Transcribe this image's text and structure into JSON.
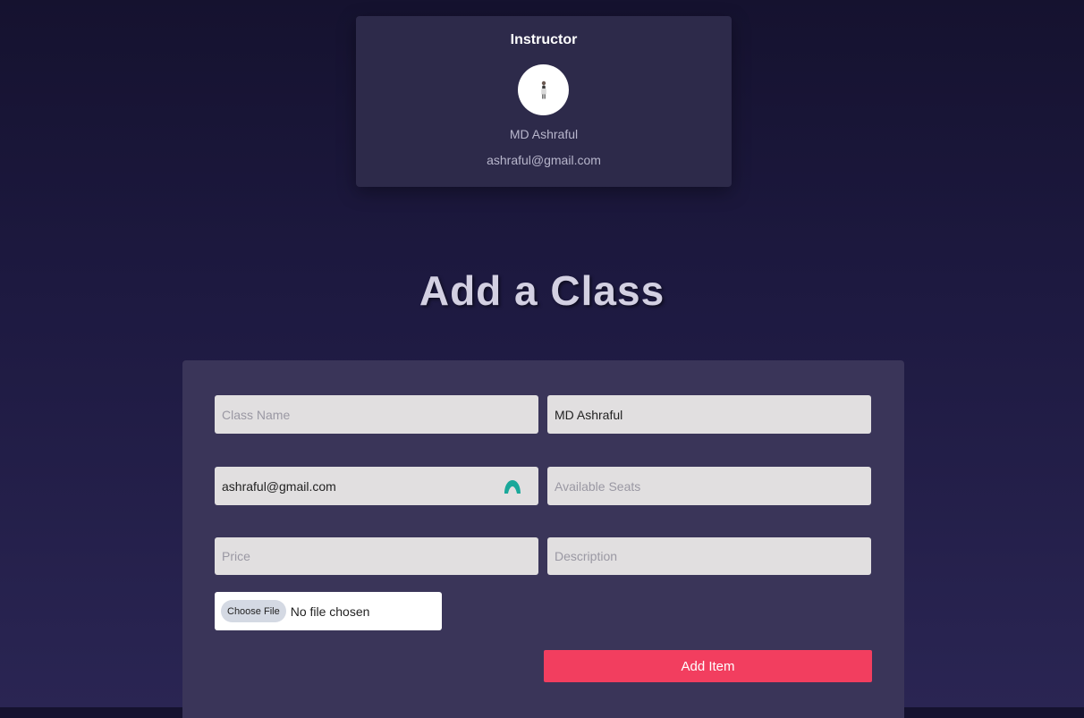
{
  "instructor_card": {
    "title": "Instructor",
    "name": "MD Ashraful",
    "email": "ashraful@gmail.com"
  },
  "heading": "Add a Class",
  "form": {
    "class_name": {
      "value": "",
      "placeholder": "Class Name"
    },
    "instructor_name": {
      "value": "MD Ashraful",
      "placeholder": ""
    },
    "instructor_email": {
      "value": "ashraful@gmail.com",
      "placeholder": ""
    },
    "available_seats": {
      "value": "",
      "placeholder": "Available Seats"
    },
    "price": {
      "value": "",
      "placeholder": "Price"
    },
    "description": {
      "value": "",
      "placeholder": "Description"
    },
    "file_button_label": "Choose File",
    "file_status": "No file chosen",
    "submit_label": "Add Item"
  },
  "colors": {
    "accent": "#f23e5f",
    "panel": "#3a3559",
    "card": "#2d2a4a",
    "extension_icon": "#1aa89a"
  },
  "icons": {
    "avatar": "person-photo",
    "email_field_extension": "password-manager-icon"
  }
}
